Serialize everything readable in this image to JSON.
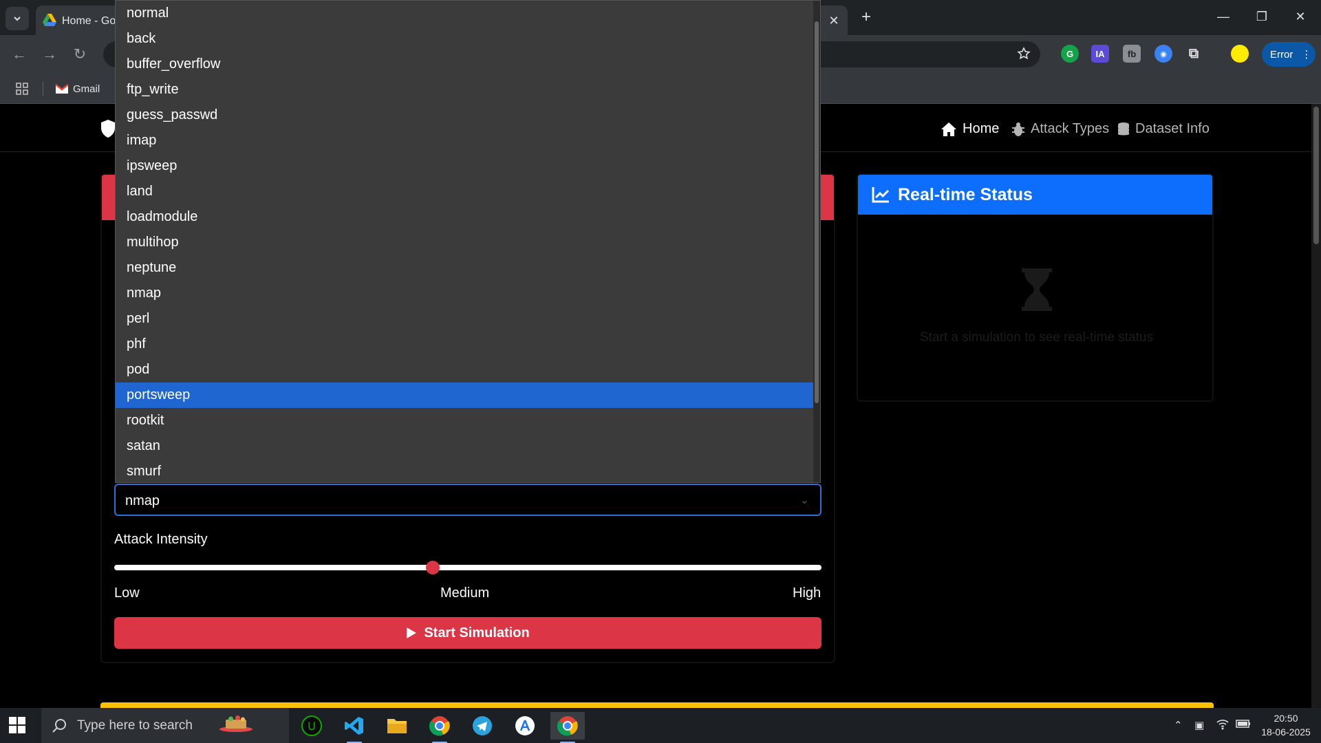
{
  "browser": {
    "tab_title": "Home - Goc",
    "error_button": "Error",
    "bookmark_gmail": "Gmail"
  },
  "navbar": {
    "home": "Home",
    "attack_types": "Attack Types",
    "dataset_info": "Dataset Info"
  },
  "simulator": {
    "attack_type_value": "nmap",
    "intensity_label": "Attack Intensity",
    "intensity_low": "Low",
    "intensity_medium": "Medium",
    "intensity_high": "High",
    "intensity_level": 0.45,
    "start_button": "Start Simulation"
  },
  "dropdown": {
    "options": [
      "normal",
      "back",
      "buffer_overflow",
      "ftp_write",
      "guess_passwd",
      "imap",
      "ipsweep",
      "land",
      "loadmodule",
      "multihop",
      "neptune",
      "nmap",
      "perl",
      "phf",
      "pod",
      "portsweep",
      "rootkit",
      "satan",
      "smurf"
    ],
    "highlighted": "portsweep"
  },
  "status_card": {
    "title": "Real-time Status",
    "message": "Start a simulation to see real-time status"
  },
  "taskbar": {
    "search_placeholder": "Type here to search",
    "time": "20:50",
    "date": "18-06-2025"
  },
  "colors": {
    "danger": "#dc3545",
    "primary": "#0d6efd",
    "warning": "#ffc107"
  }
}
